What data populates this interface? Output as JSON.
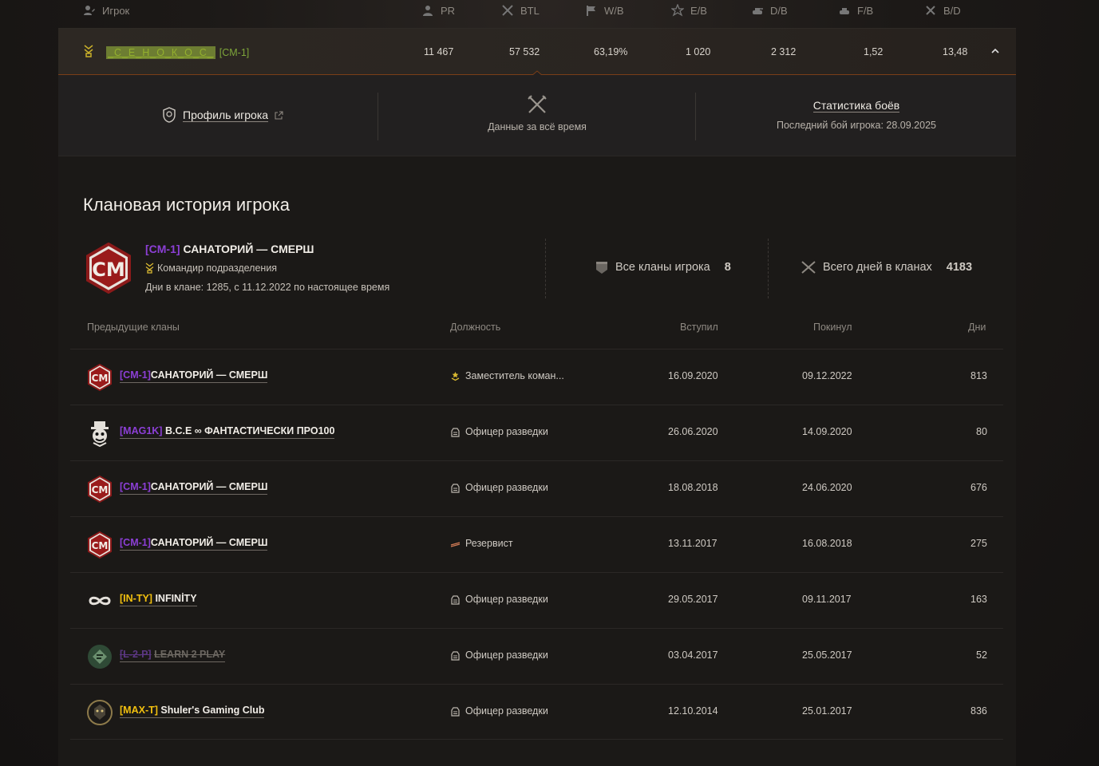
{
  "header": {
    "player": "Игрок",
    "cols": [
      "PR",
      "BTL",
      "W/B",
      "E/B",
      "D/B",
      "F/B",
      "B/D"
    ]
  },
  "player": {
    "nick": "_С_Е_Н_О_К_О_С_",
    "tag": "[CM-1]",
    "values": [
      "11 467",
      "57 532",
      "63,19%",
      "1 020",
      "2 312",
      "1,52",
      "13,48"
    ]
  },
  "subrow": {
    "profile": "Профиль игрока",
    "alltime": "Данные за всё время",
    "stats": "Статистика боёв",
    "last_battle": "Последний бой игрока: 28.09.2025"
  },
  "section_title": "Клановая история игрока",
  "current": {
    "tag": "[CM-1]",
    "name": "САНАТОРИЙ — СМЕРШ",
    "role": "Командир подразделения",
    "days_line": "Дни в клане: 1285, с 11.12.2022 по настоящее время",
    "all_clans_label": "Все кланы игрока",
    "all_clans_value": "8",
    "total_days_label": "Всего дней в кланах",
    "total_days_value": "4183"
  },
  "table": {
    "headers": {
      "clan": "Предыдущие кланы",
      "role": "Должность",
      "joined": "Вступил",
      "left": "Покинул",
      "days": "Дни"
    },
    "rows": [
      {
        "tag": "[CM-1]",
        "name": "САНАТОРИЙ — СМЕРШ",
        "role": "Заместитель коман...",
        "joined": "16.09.2020",
        "left": "09.12.2022",
        "days": "813"
      },
      {
        "tag": "[MAG1K]",
        "name": "B.C.E ∞ ФАНТАСТИЧЕСКИ ПРО100",
        "role": "Офицер разведки",
        "joined": "26.06.2020",
        "left": "14.09.2020",
        "days": "80"
      },
      {
        "tag": "[CM-1]",
        "name": "САНАТОРИЙ — СМЕРШ",
        "role": "Офицер разведки",
        "joined": "18.08.2018",
        "left": "24.06.2020",
        "days": "676"
      },
      {
        "tag": "[CM-1]",
        "name": "САНАТОРИЙ — СМЕРШ",
        "role": "Резервист",
        "joined": "13.11.2017",
        "left": "16.08.2018",
        "days": "275"
      },
      {
        "tag": "[IN-TY]",
        "name": "INFINİTY",
        "role": "Офицер разведки",
        "joined": "29.05.2017",
        "left": "09.11.2017",
        "days": "163"
      },
      {
        "tag": "[L-2-P]",
        "name": "LEARN 2 PLAY",
        "role": "Офицер разведки",
        "joined": "03.04.2017",
        "left": "25.05.2017",
        "days": "52"
      },
      {
        "tag": "[MAX-T]",
        "name": "Shuler's Gaming Club",
        "role": "Офицер разведки",
        "joined": "12.10.2014",
        "left": "25.01.2017",
        "days": "836"
      }
    ]
  },
  "colors": {
    "accent_purple": "#8c3fd6",
    "accent_yellow": "#f2c00f",
    "accent_green": "#7ea63a",
    "orange_line": "#7a3e18"
  }
}
